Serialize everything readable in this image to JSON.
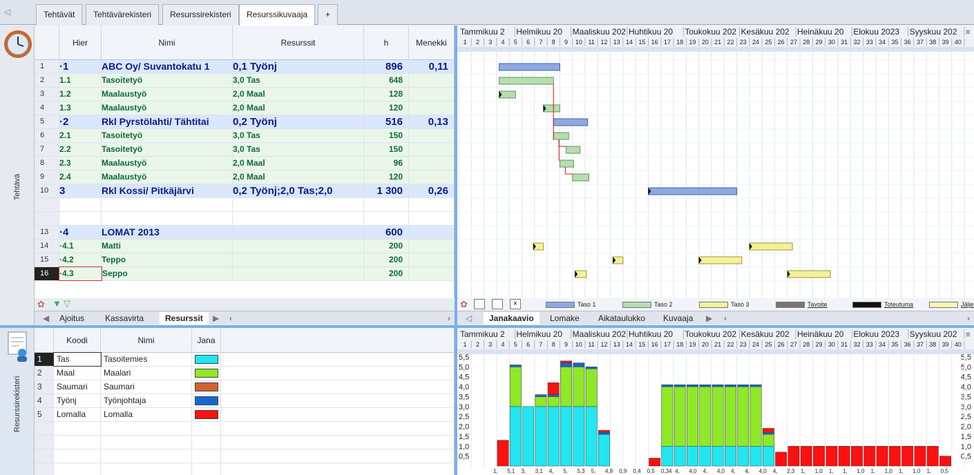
{
  "tabs": [
    "Tehtävät",
    "Tehtävärekisteri",
    "Resurssirekisteri",
    "Resurssikuvaaja",
    "+"
  ],
  "active_tab": 3,
  "side_labels": {
    "top": "Tehtävä",
    "bottom": "Resurssirekisteri"
  },
  "task_grid": {
    "headers": [
      "Hier",
      "Nimi",
      "Resurssit",
      "h",
      "Menekki"
    ],
    "rows": [
      {
        "n": "1",
        "hier": "·1",
        "name": "ABC Oy/ Suvantokatu 1",
        "res": "0,1 Työnj",
        "h": "896",
        "m": "0,11",
        "level": 0
      },
      {
        "n": "2",
        "hier": "1.1",
        "name": "Tasoitetyö",
        "res": "3,0 Tas",
        "h": "648",
        "m": "",
        "level": 1
      },
      {
        "n": "3",
        "hier": "1.2",
        "name": "Maalaustyö",
        "res": "2,0 Maal",
        "h": "128",
        "m": "",
        "level": 1
      },
      {
        "n": "4",
        "hier": "1.3",
        "name": "Maalaustyö",
        "res": "2,0 Maal",
        "h": "120",
        "m": "",
        "level": 1
      },
      {
        "n": "5",
        "hier": "·2",
        "name": "Rkl Pyrstölahti/ Tähtitai",
        "res": "0,2 Työnj",
        "h": "516",
        "m": "0,13",
        "level": 0
      },
      {
        "n": "6",
        "hier": "2.1",
        "name": "Tasoitetyö",
        "res": "3,0 Tas",
        "h": "150",
        "m": "",
        "level": 1
      },
      {
        "n": "7",
        "hier": "2.2",
        "name": "Tasoitetyö",
        "res": "3,0 Tas",
        "h": "150",
        "m": "",
        "level": 1
      },
      {
        "n": "8",
        "hier": "2.3",
        "name": "Maalaustyö",
        "res": "2,0 Maal",
        "h": "96",
        "m": "",
        "level": 1
      },
      {
        "n": "9",
        "hier": "2.4",
        "name": "Maalaustyö",
        "res": "2,0 Maal",
        "h": "120",
        "m": "",
        "level": 1
      },
      {
        "n": "10",
        "hier": "3",
        "name": "Rkl Kossi/ Pitkäjärvi",
        "res": "0,2 Työnj;2,0 Tas;2,0",
        "h": "1 300",
        "m": "0,26",
        "level": 0
      },
      {
        "n": "",
        "hier": "",
        "name": "",
        "res": "",
        "h": "",
        "m": "",
        "level": 9
      },
      {
        "n": "",
        "hier": "",
        "name": "",
        "res": "",
        "h": "",
        "m": "",
        "level": 9
      },
      {
        "n": "13",
        "hier": "·4",
        "name": "LOMAT 2013",
        "res": "",
        "h": "600",
        "m": "",
        "level": 0
      },
      {
        "n": "14",
        "hier": "·4.1",
        "name": "Matti",
        "res": "",
        "h": "200",
        "m": "",
        "level": 1
      },
      {
        "n": "15",
        "hier": "·4.2",
        "name": "Teppo",
        "res": "",
        "h": "200",
        "m": "",
        "level": 1
      },
      {
        "n": "16",
        "hier": "·4.3",
        "name": "Seppo",
        "res": "",
        "h": "200",
        "m": "",
        "level": 1
      }
    ]
  },
  "top_left_tabs": [
    "Ajoitus",
    "Kassavirta",
    "Resurssit"
  ],
  "top_right_tabs": [
    "Janakaavio",
    "Lomake",
    "Aikataulukko",
    "Kuvaaja"
  ],
  "months": [
    "Tammikuu 2",
    "Helmikuu 20",
    "Maaliskuu 202",
    "Huhtikuu 20",
    "Toukokuu 202",
    "Kesäkuu 202",
    "Heinäkuu 20",
    "Elokuu 2023",
    "Syyskuu 202"
  ],
  "weeks": [
    "1",
    "2",
    "3",
    "4",
    "5",
    "6",
    "7",
    "8",
    "9",
    "10",
    "11",
    "12",
    "13",
    "14",
    "15",
    "16",
    "17",
    "18",
    "19",
    "20",
    "21",
    "22",
    "23",
    "24",
    "25",
    "26",
    "27",
    "28",
    "29",
    "30",
    "31",
    "32",
    "33",
    "34",
    "35",
    "36",
    "37",
    "38",
    "39",
    "40"
  ],
  "legend": [
    {
      "label": "Taso 1",
      "color": "#8fa9e0"
    },
    {
      "label": "Taso 2",
      "color": "#b7ddb0"
    },
    {
      "label": "Taso 3",
      "color": "#f5f19a"
    },
    {
      "label": "Tavoite",
      "color": "#777777"
    },
    {
      "label": "Toteutuma",
      "color": "#111111"
    },
    {
      "label": "Jäljellä",
      "color": "#fbf4b2"
    }
  ],
  "gantt_bars": [
    {
      "row": 0,
      "start": 4.2,
      "end": 9.0,
      "level": 0
    },
    {
      "row": 1,
      "start": 4.2,
      "end": 8.5,
      "level": 1
    },
    {
      "row": 2,
      "start": 4.2,
      "end": 5.5,
      "level": 1
    },
    {
      "row": 3,
      "start": 7.7,
      "end": 9.0,
      "level": 1
    },
    {
      "row": 4,
      "start": 8.5,
      "end": 11.2,
      "level": 0
    },
    {
      "row": 5,
      "start": 8.5,
      "end": 9.7,
      "level": 1
    },
    {
      "row": 6,
      "start": 9.5,
      "end": 10.6,
      "level": 1
    },
    {
      "row": 7,
      "start": 9.0,
      "end": 10.1,
      "level": 1
    },
    {
      "row": 8,
      "start": 10.0,
      "end": 11.3,
      "level": 1
    },
    {
      "row": 9,
      "start": 16.0,
      "end": 23.0,
      "level": 0
    },
    {
      "row": 13,
      "start": 6.9,
      "end": 7.7,
      "level": 2
    },
    {
      "row": 13,
      "start": 24.0,
      "end": 27.4,
      "level": 2
    },
    {
      "row": 14,
      "start": 13.2,
      "end": 14.0,
      "level": 2
    },
    {
      "row": 14,
      "start": 20.0,
      "end": 23.4,
      "level": 2
    },
    {
      "row": 15,
      "start": 10.2,
      "end": 11.1,
      "level": 2
    },
    {
      "row": 15,
      "start": 27.0,
      "end": 30.4,
      "level": 2
    }
  ],
  "resource_grid": {
    "headers": [
      "Koodi",
      "Nimi",
      "Jana"
    ],
    "rows": [
      {
        "n": "1",
        "code": "Tas",
        "name": "Tasoitemies",
        "color": "#22e6f0"
      },
      {
        "n": "2",
        "code": "Maal",
        "name": "Maalari",
        "color": "#8fe828"
      },
      {
        "n": "3",
        "code": "Saumari",
        "name": "Saumari",
        "color": "#d2622f"
      },
      {
        "n": "4",
        "code": "Työnj",
        "name": "Työnjohtaja",
        "color": "#1466d6"
      },
      {
        "n": "5",
        "code": "Lomalla",
        "name": "Lomalla",
        "color": "#ff1010"
      }
    ]
  },
  "chart_data": {
    "type": "bar",
    "stacked": true,
    "categories": [
      "1",
      "2",
      "3",
      "4",
      "5",
      "6",
      "7",
      "8",
      "9",
      "10",
      "11",
      "12",
      "13",
      "14",
      "15",
      "16",
      "17",
      "18",
      "19",
      "20",
      "21",
      "22",
      "23",
      "24",
      "25",
      "26",
      "27",
      "28",
      "29",
      "30",
      "31",
      "32",
      "33",
      "34",
      "35",
      "36",
      "37",
      "38",
      "39",
      "40"
    ],
    "ylim": [
      0,
      5.5
    ],
    "yticks": [
      "5,5",
      "5,0",
      "4,5",
      "4,0",
      "3,5",
      "3,0",
      "2,5",
      "2,0",
      "1,5",
      "1,0",
      "0,5"
    ],
    "series": [
      {
        "name": "Tas",
        "color": "#22e6f0",
        "values": [
          0,
          0,
          0,
          0,
          3,
          3,
          3,
          3,
          3,
          3,
          3,
          1.6,
          0,
          0,
          0,
          0,
          1,
          1,
          1,
          1,
          1,
          1,
          1,
          1,
          1,
          0,
          0,
          0,
          0,
          0,
          0,
          0,
          0,
          0,
          0,
          0,
          0,
          0,
          0,
          0
        ]
      },
      {
        "name": "Maal",
        "color": "#8fe828",
        "values": [
          0,
          0,
          0,
          0,
          2,
          0,
          0.5,
          0.5,
          2,
          2,
          1.9,
          0,
          0,
          0,
          0,
          0,
          3,
          3,
          3,
          3,
          3,
          3,
          3,
          3,
          0.6,
          0,
          0,
          0,
          0,
          0,
          0,
          0,
          0,
          0,
          0,
          0,
          0,
          0,
          0,
          0
        ]
      },
      {
        "name": "Työnj",
        "color": "#1466d6",
        "values": [
          0,
          0,
          0,
          0,
          0.1,
          0,
          0.1,
          0.1,
          0.2,
          0.2,
          0.1,
          0.1,
          0,
          0,
          0,
          0,
          0.1,
          0.1,
          0.1,
          0.1,
          0.1,
          0.1,
          0.1,
          0.1,
          0.1,
          0,
          0,
          0,
          0,
          0,
          0,
          0,
          0,
          0,
          0,
          0,
          0,
          0,
          0,
          0
        ]
      },
      {
        "name": "Lomalla",
        "color": "#ff1010",
        "values": [
          0,
          0,
          0,
          1.3,
          0,
          0,
          0,
          0.6,
          0.1,
          0,
          0,
          0.1,
          0,
          0,
          0,
          0.4,
          0,
          0,
          0,
          0,
          0,
          0,
          0,
          0,
          0.2,
          0.7,
          1,
          1,
          1,
          1,
          1,
          1,
          1,
          1,
          1,
          1,
          1,
          1,
          0.5,
          0
        ]
      }
    ],
    "data_labels": [
      "1,",
      "5,1",
      "3,",
      "3,1",
      "4,",
      "5,",
      "5,3",
      "5,",
      "4,8",
      "0,9",
      "0,4",
      "0,5",
      "0,34",
      "4,",
      "4,0",
      "4,",
      "4,0",
      "4,",
      "4,",
      "4,0",
      "4,",
      "2,3",
      "1,",
      "1,0",
      "1,",
      "1,",
      "1,0",
      "1,",
      "1,0",
      "1,",
      "1,0",
      "1,",
      "0,5"
    ]
  }
}
